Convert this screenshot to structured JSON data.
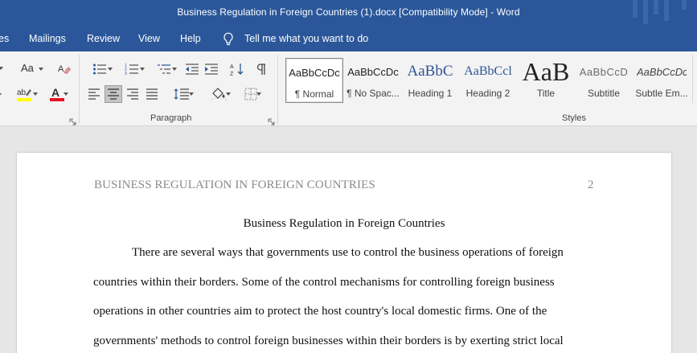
{
  "window": {
    "title": "Business Regulation in Foreign Countries (1).docx [Compatibility Mode]  -  Word",
    "accent_color": "#2b579a"
  },
  "ribbon_tabs": [
    "es",
    "Mailings",
    "Review",
    "View",
    "Help"
  ],
  "tell_me": {
    "icon": "lightbulb-icon",
    "text": "Tell me what you want to do"
  },
  "groups": {
    "paragraph": "Paragraph",
    "styles": "Styles"
  },
  "font_controls": {
    "change_case": "Aa",
    "highlight_color": "#ffff00",
    "font_color": "#e81123"
  },
  "styles_gallery": [
    {
      "preview": "AaBbCcDc",
      "label": "¶ Normal",
      "selected": true
    },
    {
      "preview": "AaBbCcDc",
      "label": "¶ No Spac...",
      "selected": false
    },
    {
      "preview": "AaBbC",
      "label": "Heading 1",
      "selected": false
    },
    {
      "preview": "AaBbCcl",
      "label": "Heading 2",
      "selected": false
    },
    {
      "preview": "AaB",
      "label": "Title",
      "selected": false
    },
    {
      "preview": "AaBbCcD",
      "label": "Subtitle",
      "selected": false
    },
    {
      "preview": "AaBbCcDc",
      "label": "Subtle Em...",
      "selected": false
    }
  ],
  "document": {
    "header_title": "BUSINESS REGULATION IN FOREIGN COUNTRIES",
    "page_number": "2",
    "title": "Business Regulation in Foreign Countries",
    "lines": [
      "There are several ways that governments use to control the business operations of foreign",
      "countries within their borders. Some of the control mechanisms for controlling foreign business",
      "operations in other countries aim to protect the host country's local domestic firms. One of the",
      "governments' methods to control foreign businesses within their borders is by exerting strict local"
    ]
  }
}
